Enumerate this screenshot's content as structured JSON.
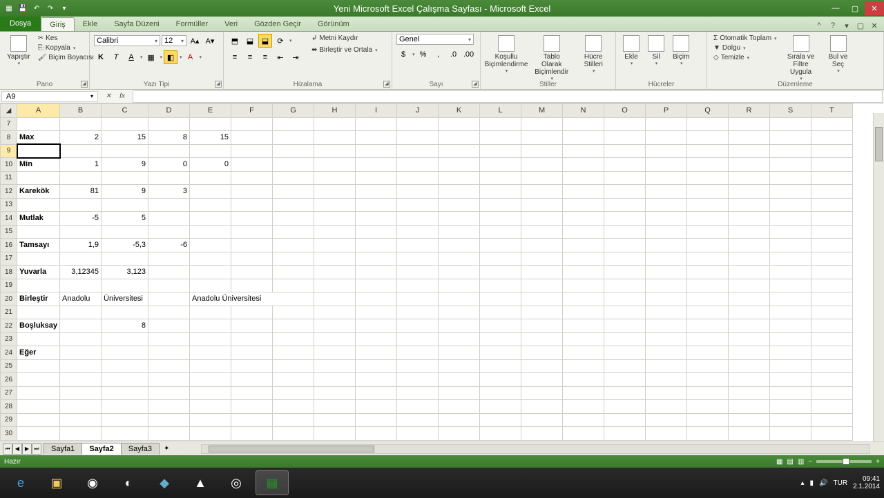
{
  "titlebar": {
    "title": "Yeni Microsoft Excel Çalışma Sayfası - Microsoft Excel"
  },
  "tabs": {
    "file": "Dosya",
    "items": [
      "Giriş",
      "Ekle",
      "Sayfa Düzeni",
      "Formüller",
      "Veri",
      "Gözden Geçir",
      "Görünüm"
    ],
    "active": 0
  },
  "ribbon": {
    "clipboard": {
      "paste": "Yapıştır",
      "cut": "Kes",
      "copy": "Kopyala",
      "painter": "Biçim Boyacısı",
      "label": "Pano"
    },
    "font": {
      "name": "Calibri",
      "size": "12",
      "bold": "K",
      "italic": "T",
      "underline": "A",
      "label": "Yazı Tipi"
    },
    "align": {
      "wrap": "Metni Kaydır",
      "merge": "Birleştir ve Ortala",
      "label": "Hizalama"
    },
    "number": {
      "format": "Genel",
      "label": "Sayı"
    },
    "styles": {
      "cond": "Koşullu Biçimlendirme",
      "table": "Tablo Olarak Biçimlendir",
      "cell": "Hücre Stilleri",
      "label": "Stiller"
    },
    "cells": {
      "insert": "Ekle",
      "delete": "Sil",
      "format": "Biçim",
      "label": "Hücreler"
    },
    "editing": {
      "autosum": "Otomatik Toplam",
      "fill": "Dolgu",
      "clear": "Temizle",
      "sort": "Sırala ve Filtre Uygula",
      "find": "Bul ve Seç",
      "label": "Düzenleme"
    }
  },
  "namebox": "A9",
  "columns": [
    "A",
    "B",
    "C",
    "D",
    "E",
    "F",
    "G",
    "H",
    "I",
    "J",
    "K",
    "L",
    "M",
    "N",
    "O",
    "P",
    "Q",
    "R",
    "S",
    "T"
  ],
  "rows": [
    {
      "n": 7,
      "cells": [
        "",
        "",
        "",
        "",
        ""
      ]
    },
    {
      "n": 8,
      "cells": [
        "Max",
        "2",
        "15",
        "8",
        "15"
      ]
    },
    {
      "n": 9,
      "cells": [
        "",
        "",
        "",
        "",
        ""
      ]
    },
    {
      "n": 10,
      "cells": [
        "Min",
        "1",
        "9",
        "0",
        "0"
      ]
    },
    {
      "n": 11,
      "cells": [
        "",
        "",
        "",
        "",
        ""
      ]
    },
    {
      "n": 12,
      "cells": [
        "Karekök",
        "81",
        "9",
        "3",
        ""
      ]
    },
    {
      "n": 13,
      "cells": [
        "",
        "",
        "",
        "",
        ""
      ]
    },
    {
      "n": 14,
      "cells": [
        "Mutlak",
        "-5",
        "5",
        "",
        ""
      ]
    },
    {
      "n": 15,
      "cells": [
        "",
        "",
        "",
        "",
        ""
      ]
    },
    {
      "n": 16,
      "cells": [
        "Tamsayı",
        "1,9",
        "-5,3",
        "-6",
        ""
      ]
    },
    {
      "n": 17,
      "cells": [
        "",
        "",
        "",
        "",
        ""
      ]
    },
    {
      "n": 18,
      "cells": [
        "Yuvarla",
        "3,12345",
        "3,123",
        "",
        ""
      ]
    },
    {
      "n": 19,
      "cells": [
        "",
        "",
        "",
        "",
        ""
      ]
    },
    {
      "n": 20,
      "cells": [
        "Birleştir",
        "Anadolu",
        "Üniversitesi",
        "",
        "Anadolu Üniversitesi"
      ]
    },
    {
      "n": 21,
      "cells": [
        "",
        "",
        "",
        "",
        ""
      ]
    },
    {
      "n": 22,
      "cells": [
        "Boşluksay",
        "",
        "8",
        "",
        ""
      ]
    },
    {
      "n": 23,
      "cells": [
        "",
        "",
        "",
        "",
        ""
      ]
    },
    {
      "n": 24,
      "cells": [
        "Eğer",
        "",
        "",
        "",
        ""
      ]
    },
    {
      "n": 25,
      "cells": [
        "",
        "",
        "",
        "",
        ""
      ]
    },
    {
      "n": 26,
      "cells": [
        "",
        "",
        "",
        "",
        ""
      ]
    },
    {
      "n": 27,
      "cells": [
        "",
        "",
        "",
        "",
        ""
      ]
    },
    {
      "n": 28,
      "cells": [
        "",
        "",
        "",
        "",
        ""
      ]
    },
    {
      "n": 29,
      "cells": [
        "",
        "",
        "",
        "",
        ""
      ]
    },
    {
      "n": 30,
      "cells": [
        "",
        "",
        "",
        "",
        ""
      ]
    }
  ],
  "bold_rows": [
    8,
    10,
    12,
    14,
    16,
    18,
    20,
    22,
    24
  ],
  "text_col_a_rows": [
    20
  ],
  "active_cell": {
    "row": 9,
    "col": 0
  },
  "sheets": {
    "tabs": [
      "Sayfa1",
      "Sayfa2",
      "Sayfa3"
    ],
    "active": 1
  },
  "status": {
    "ready": "Hazır",
    "lang": "TUR",
    "time": "09:41",
    "date": "2.1.2014"
  }
}
